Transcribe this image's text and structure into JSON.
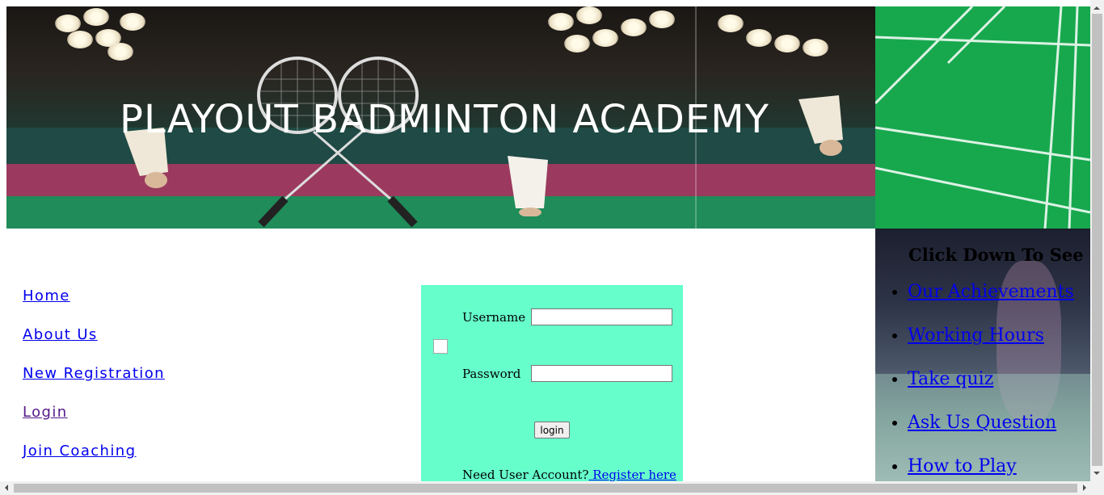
{
  "header": {
    "title": "PLAYOUT BADMINTON ACADEMY"
  },
  "side_nav": {
    "items": [
      {
        "label": "Home"
      },
      {
        "label": "About Us"
      },
      {
        "label": "New Registration"
      },
      {
        "label": "Login"
      },
      {
        "label": "Join Coaching"
      }
    ]
  },
  "login": {
    "username_label": "Username",
    "password_label": "Password",
    "username_value": "",
    "password_value": "",
    "button_label": "login",
    "need_account_text": "Need User Account?",
    "register_link": " Register here"
  },
  "right_panel": {
    "heading": "Click Down To See",
    "items": [
      {
        "label": "Our Achievements"
      },
      {
        "label": "Working Hours"
      },
      {
        "label": "Take quiz"
      },
      {
        "label": "Ask Us Question"
      },
      {
        "label": "How to Play"
      }
    ]
  },
  "colors": {
    "login_background": "#66ffcc",
    "link": "#0000ee",
    "visited_link": "#551a8b",
    "court_green": "#17a84e"
  }
}
